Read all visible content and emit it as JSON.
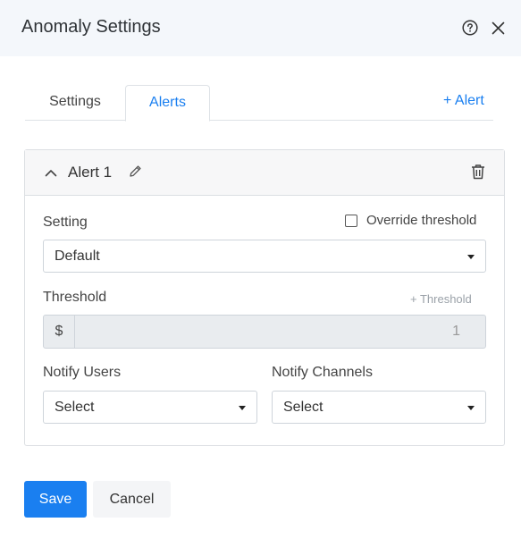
{
  "dialog": {
    "title": "Anomaly Settings",
    "help_icon": "help-circle-icon",
    "close_icon": "close-icon"
  },
  "tabs": [
    {
      "label": "Settings",
      "active": false
    },
    {
      "label": "Alerts",
      "active": true
    }
  ],
  "add_alert_label": "+ Alert",
  "alert": {
    "name": "Alert 1",
    "collapse_icon": "chevron-up-icon",
    "edit_icon": "pencil-icon",
    "delete_icon": "trash-icon",
    "setting_label": "Setting",
    "override_label": "Override threshold",
    "override_checked": false,
    "setting_value": "Default",
    "threshold_label": "Threshold",
    "add_threshold_label": "+ Threshold",
    "threshold_prefix": "$",
    "threshold_value": "1",
    "notify_users_label": "Notify Users",
    "notify_users_value": "Select",
    "notify_channels_label": "Notify Channels",
    "notify_channels_value": "Select"
  },
  "footer": {
    "save_label": "Save",
    "cancel_label": "Cancel"
  },
  "colors": {
    "accent": "#1a7ff0",
    "header_bg": "#f4f7fb"
  }
}
